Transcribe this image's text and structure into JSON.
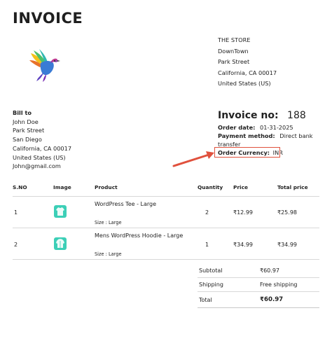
{
  "invoice_title": "INVOICE",
  "store": {
    "lines": [
      "THE STORE",
      "DownTown",
      "Park Street",
      "California, CA 00017",
      "United States (US)"
    ]
  },
  "bill_to": {
    "heading": "Bill to",
    "lines": [
      "John Doe",
      "Park Street",
      "San Diego",
      "California, CA 00017",
      "United States (US)",
      "John@gmail.com"
    ]
  },
  "invoice": {
    "no_label": "Invoice no:",
    "no_value": "188",
    "date_label": "Order date:",
    "date_value": "01-31-2025",
    "payment_label": "Payment method:",
    "payment_value_1": "Direct bank",
    "payment_value_2": "transfer",
    "currency_label": "Order Currency:",
    "currency_value": "INR"
  },
  "table": {
    "headers": [
      "S.NO",
      "Image",
      "Product",
      "Quantity",
      "Price",
      "Total price"
    ],
    "rows": [
      {
        "sno": "1",
        "product": "WordPress Tee - Large",
        "meta": "Size : Large",
        "qty": "2",
        "price": "₹12.99",
        "total": "₹25.98",
        "icon": "tshirt-icon"
      },
      {
        "sno": "2",
        "product": "Mens WordPress Hoodie - Large",
        "meta": "Size : Large",
        "qty": "1",
        "price": "₹34.99",
        "total": "₹34.99",
        "icon": "hoodie-icon"
      }
    ]
  },
  "totals": {
    "subtotal_label": "Subtotal",
    "subtotal_value": "₹60.97",
    "shipping_label": "Shipping",
    "shipping_value": "Free shipping",
    "total_label": "Total",
    "total_value": "₹60.97"
  },
  "colors": {
    "highlight": "#e0513d",
    "thumb": "#3ccfb7"
  }
}
